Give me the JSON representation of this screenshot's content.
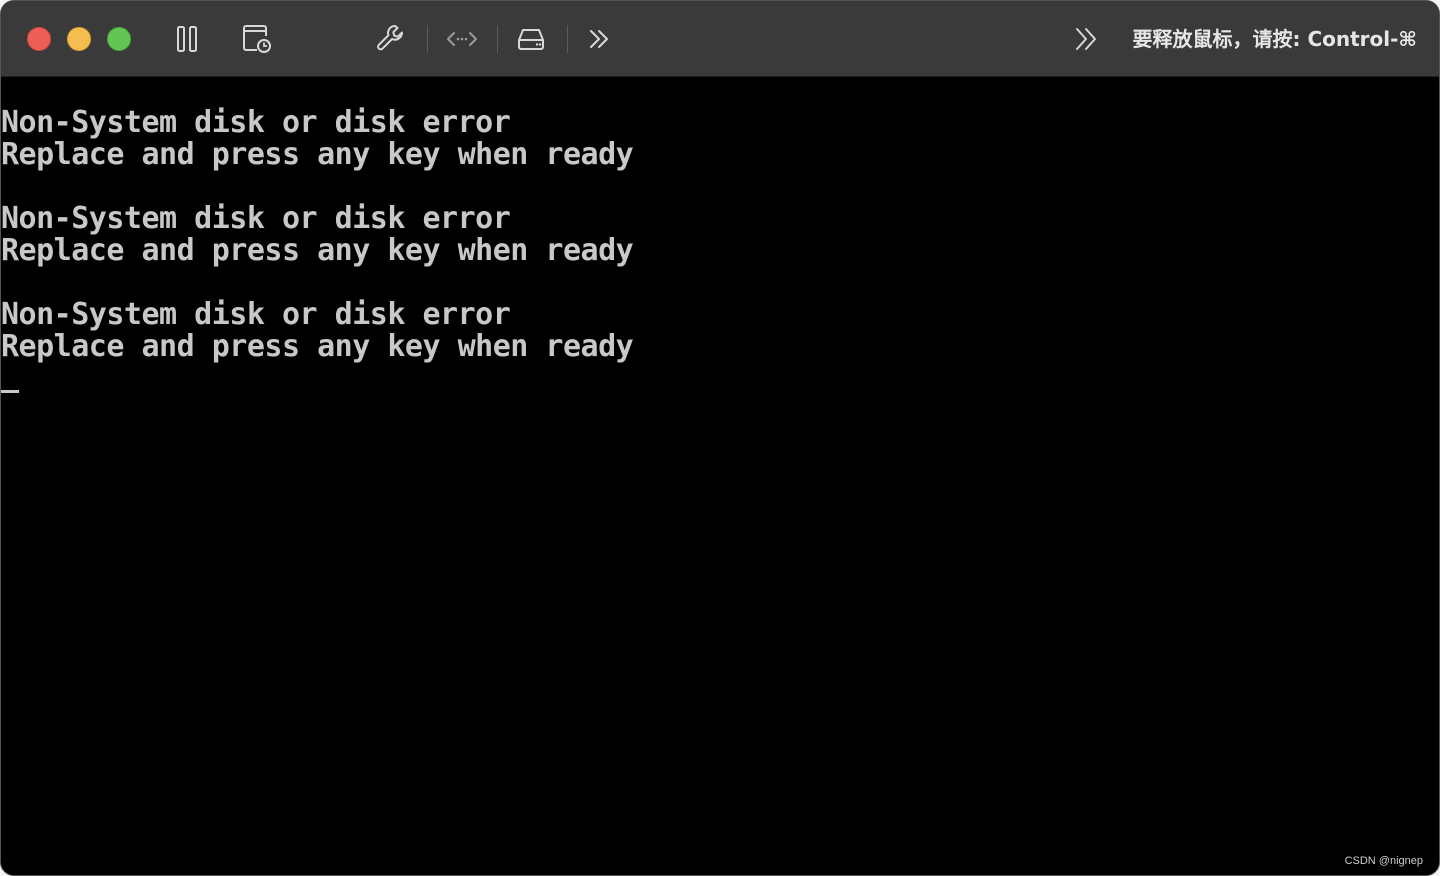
{
  "window": {
    "traffic_lights": {
      "close_color": "#ed5e57",
      "minimize_color": "#f5bd4f",
      "zoom_color": "#62c554"
    }
  },
  "toolbar": {
    "icons": [
      "pause-icon",
      "snapshot-icon",
      "wrench-icon",
      "code-icon",
      "drive-icon",
      "forward-icon"
    ],
    "release_hint": "要释放鼠标，请按: Control-⌘"
  },
  "console": {
    "lines": [
      "Non-System disk or disk error",
      "Replace and press any key when ready",
      "",
      "Non-System disk or disk error",
      "Replace and press any key when ready",
      "",
      "Non-System disk or disk error",
      "Replace and press any key when ready"
    ],
    "text_color": "#c8c8c8",
    "background_color": "#000000"
  },
  "watermark": "CSDN @nignep"
}
